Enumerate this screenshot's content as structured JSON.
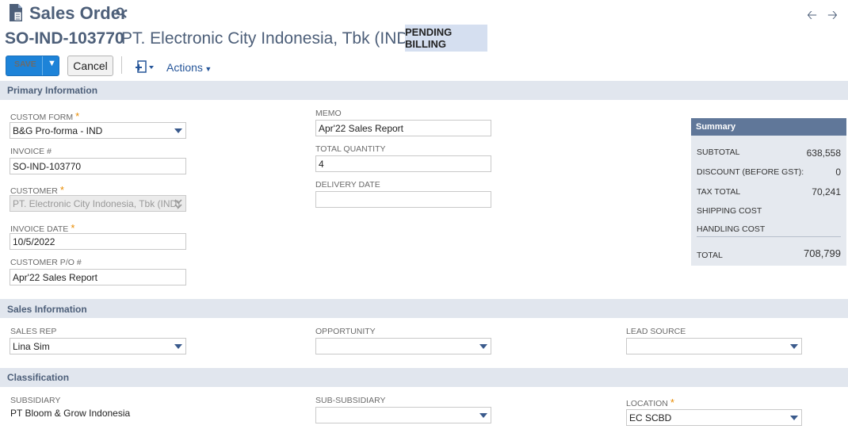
{
  "header": {
    "title": "Sales Order",
    "record_id": "SO-IND-103770",
    "customer_name": "PT. Electronic City Indonesia, Tbk (IND)",
    "status": "PENDING BILLING"
  },
  "toolbar": {
    "save_label": "Save",
    "cancel_label": "Cancel",
    "actions_label": "Actions"
  },
  "sections": {
    "primary": "Primary Information",
    "sales": "Sales Information",
    "classification": "Classification"
  },
  "primary": {
    "custom_form_label": "CUSTOM FORM",
    "custom_form_value": "B&G Pro-forma - IND",
    "invoice_label": "INVOICE #",
    "invoice_value": "SO-IND-103770",
    "customer_label": "CUSTOMER",
    "customer_value": "PT. Electronic City Indonesia, Tbk (IND)",
    "invoice_date_label": "INVOICE DATE",
    "invoice_date_value": "10/5/2022",
    "po_label": "CUSTOMER P/O #",
    "po_value": "Apr'22 Sales Report",
    "memo_label": "MEMO",
    "memo_value": "Apr'22 Sales Report",
    "total_qty_label": "TOTAL QUANTITY",
    "total_qty_value": "4",
    "delivery_date_label": "DELIVERY DATE",
    "delivery_date_value": ""
  },
  "summary": {
    "title": "Summary",
    "subtotal_label": "SUBTOTAL",
    "subtotal_value": "638,558",
    "discount_label": "DISCOUNT (BEFORE GST):",
    "discount_value": "0",
    "tax_label": "TAX TOTAL",
    "tax_value": "70,241",
    "shipping_label": "SHIPPING COST",
    "handling_label": "HANDLING COST",
    "total_label": "TOTAL",
    "total_value": "708,799"
  },
  "sales": {
    "rep_label": "SALES REP",
    "rep_value": "Lina Sim",
    "opportunity_label": "OPPORTUNITY",
    "opportunity_value": "",
    "lead_label": "LEAD SOURCE",
    "lead_value": ""
  },
  "classification": {
    "subsidiary_label": "SUBSIDIARY",
    "subsidiary_value": "PT Bloom & Grow Indonesia",
    "sub_subsidiary_label": "SUB-SUBSIDIARY",
    "sub_subsidiary_value": "",
    "location_label": "LOCATION",
    "location_value": "EC SCBD"
  },
  "colors": {
    "accent": "#1d83d8",
    "header_text": "#4d5f79",
    "section_bg": "#e1e6ee",
    "summary_head": "#607799",
    "required": "#e88b00"
  },
  "icons": [
    "document-icon",
    "search-icon",
    "back-arrow-icon",
    "forward-arrow-icon",
    "print-icon",
    "dropdown-caret-icon"
  ]
}
